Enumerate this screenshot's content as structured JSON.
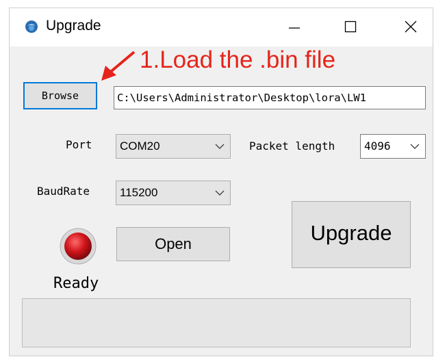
{
  "window": {
    "title": "Upgrade",
    "minimize_icon": "minimize-icon",
    "maximize_icon": "maximize-icon",
    "close_icon": "close-icon"
  },
  "annotation": {
    "text": "1.Load the .bin file",
    "color": "#e5241b"
  },
  "browse": {
    "label": "Browse",
    "path_value": "C:\\Users\\Administrator\\Desktop\\lora\\LW1"
  },
  "port": {
    "label": "Port",
    "value": "COM20"
  },
  "packet_length": {
    "label": "Packet length",
    "value": "4096"
  },
  "baudrate": {
    "label": "BaudRate",
    "value": "115200"
  },
  "buttons": {
    "open": "Open",
    "upgrade": "Upgrade"
  },
  "status": {
    "text": "Ready",
    "led_color": "#d0141b"
  },
  "progress": {
    "value_percent": 0
  },
  "colors": {
    "focus_border": "#0078d7",
    "dialog_bg": "#f0f0f0"
  }
}
